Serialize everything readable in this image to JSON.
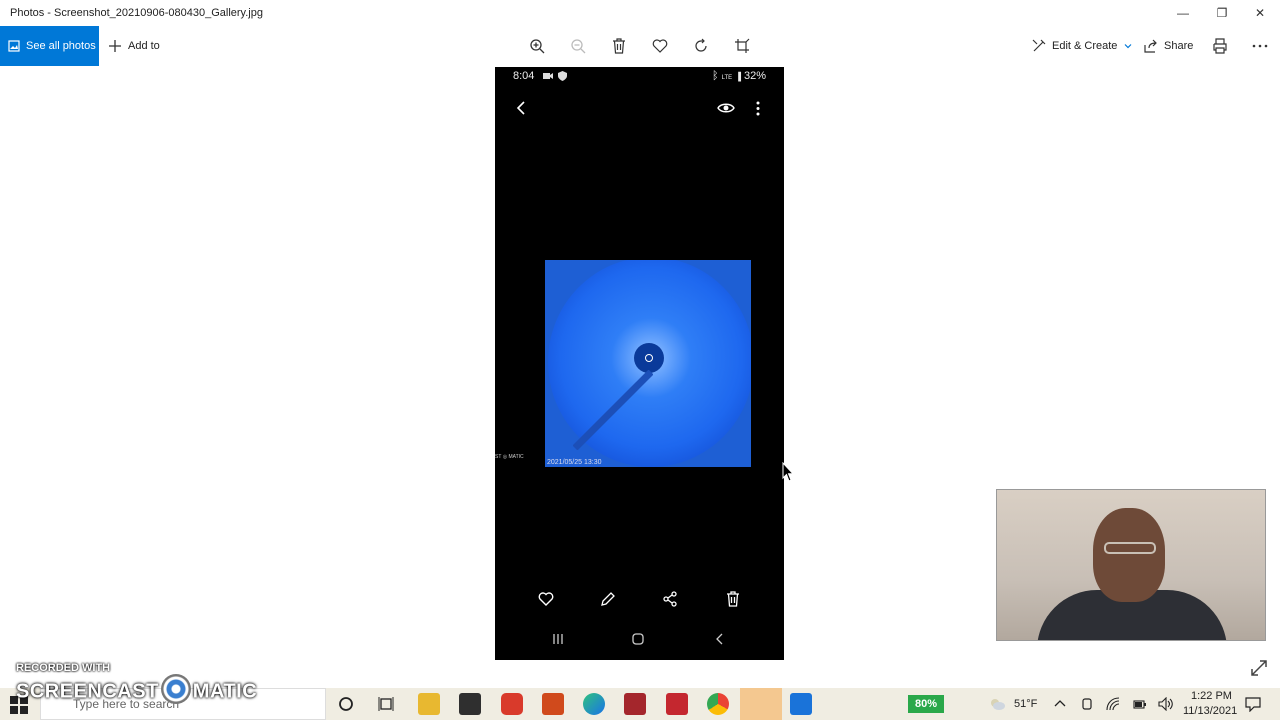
{
  "window": {
    "title": "Photos - Screenshot_20210906-080430_Gallery.jpg",
    "minimize": "—",
    "restore": "❐",
    "close": "✕"
  },
  "toolbar": {
    "see_all_label": "See all photos",
    "add_to_label": "Add to",
    "edit_create_label": "Edit & Create",
    "share_label": "Share",
    "icons": [
      "zoom-in-icon",
      "zoom-out-icon",
      "delete-icon",
      "heart-icon",
      "rotate-icon",
      "crop-icon",
      "print-icon",
      "more-icon"
    ]
  },
  "phone": {
    "time": "8:04",
    "battery": "32%",
    "network": "LTE",
    "image_date": "2021/05/25 13:30",
    "watermark": "ST ◎ MATIC"
  },
  "overlay": {
    "recorded_with": "RECORDED WITH",
    "brand_left": "SCREENCAST",
    "brand_right": "MATIC"
  },
  "taskbar": {
    "search_placeholder": "Type here to search",
    "battery_percent": "80%",
    "weather": "51°F",
    "time": "1:22 PM",
    "date": "11/13/2021"
  },
  "colors": {
    "accent": "#0078d7",
    "phone_bg": "#000000",
    "coronagraph": "#1e5fd4",
    "battery_green": "#2aa84a"
  }
}
